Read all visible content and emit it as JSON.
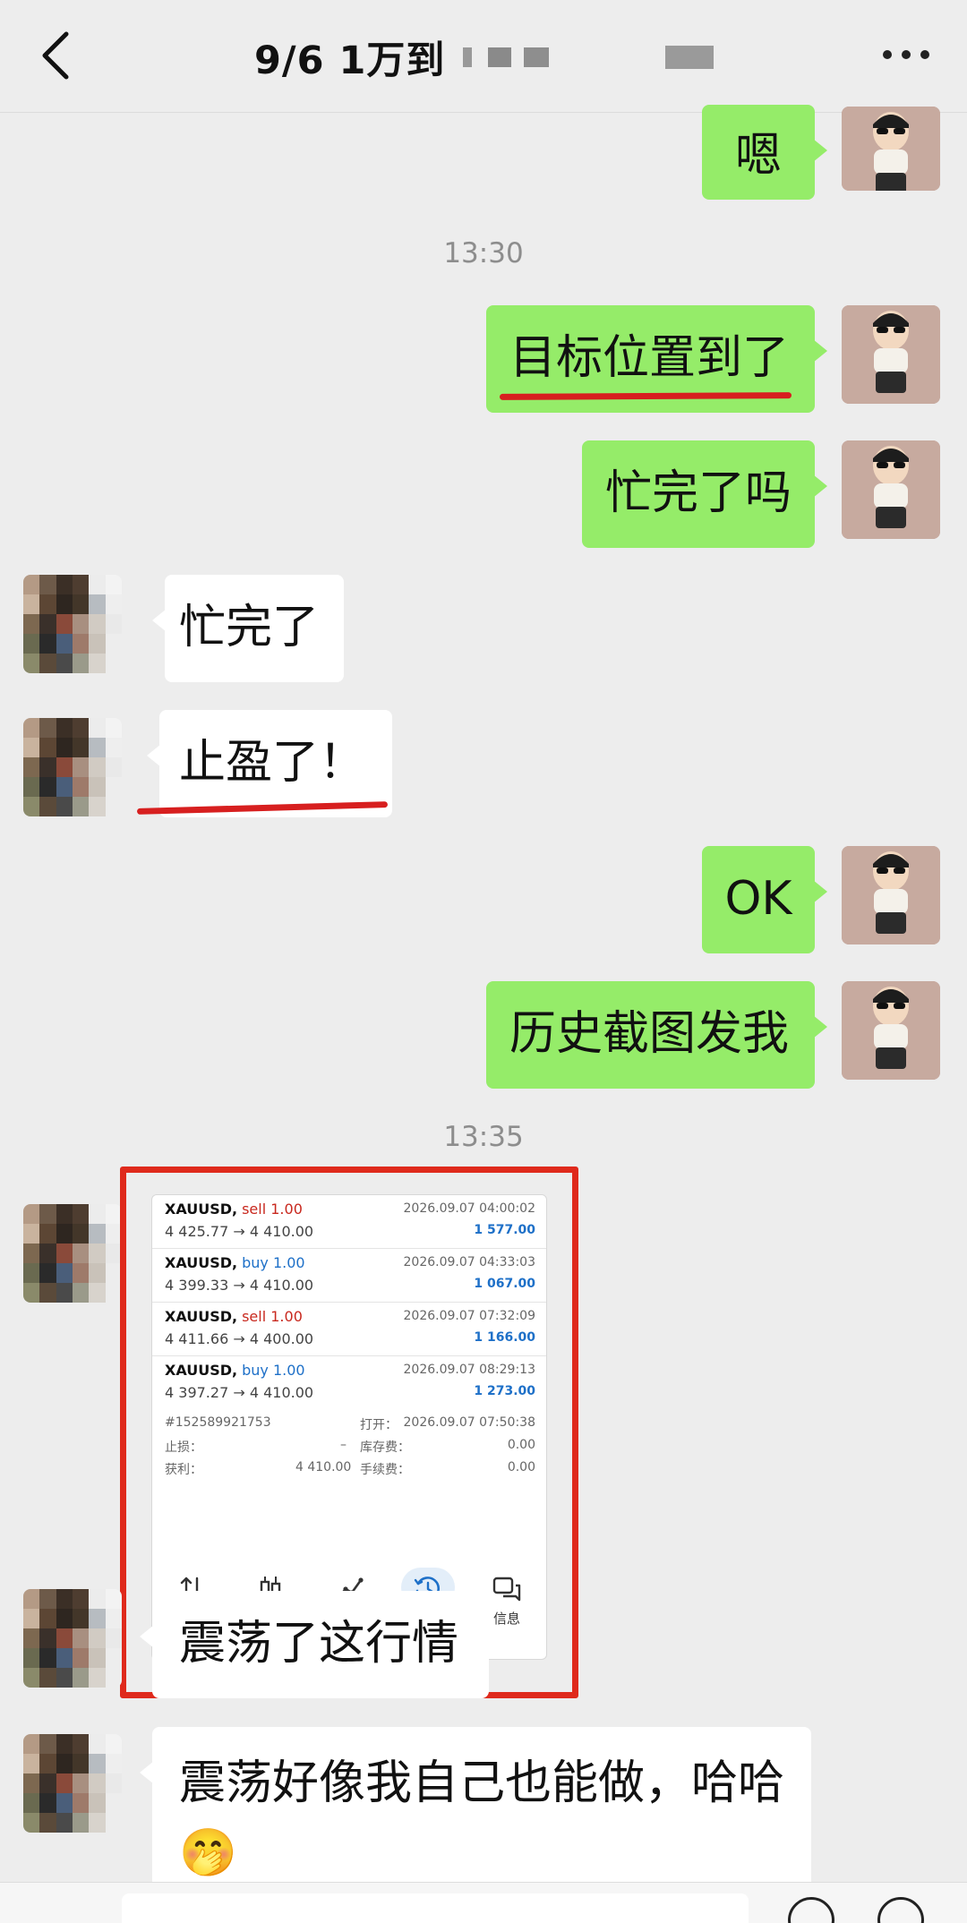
{
  "header": {
    "title": "9/6  1万到",
    "back_icon": "chevron-left-icon",
    "more_icon": "more-dots-icon"
  },
  "colors": {
    "outgoing_bubble": "#95ec69",
    "incoming_bubble": "#ffffff",
    "highlight_underline": "#d71f1f",
    "image_frame": "#df2a1c",
    "background": "#ededed"
  },
  "messages": [
    {
      "side": "out",
      "text": "嗯"
    },
    {
      "type": "time",
      "text": "13:30"
    },
    {
      "side": "out",
      "text": "目标位置到了",
      "underlined": true
    },
    {
      "side": "out",
      "text": "忙完了吗"
    },
    {
      "side": "in",
      "text": "忙完了"
    },
    {
      "side": "in",
      "text": "止盈了！",
      "underlined": true
    },
    {
      "side": "out",
      "text": "OK"
    },
    {
      "side": "out",
      "text": "历史截图发我"
    },
    {
      "type": "time",
      "text": "13:35"
    },
    {
      "side": "in",
      "type": "image"
    },
    {
      "side": "in",
      "text": "震荡了这行情"
    },
    {
      "side": "in",
      "text": "震荡好像我自己也能做，哈哈🤭"
    }
  ],
  "trade_screenshot": {
    "trades": [
      {
        "symbol": "XAUUSD,",
        "side": "sell 1.00",
        "side_kind": "sell",
        "prices": "4 425.77 → 4 410.00",
        "date": "2026.09.07 04:00:02",
        "profit": "1 577.00"
      },
      {
        "symbol": "XAUUSD,",
        "side": "buy 1.00",
        "side_kind": "buy",
        "prices": "4 399.33 → 4 410.00",
        "date": "2026.09.07 04:33:03",
        "profit": "1 067.00"
      },
      {
        "symbol": "XAUUSD,",
        "side": "sell 1.00",
        "side_kind": "sell",
        "prices": "4 411.66 → 4 400.00",
        "date": "2026.09.07 07:32:09",
        "profit": "1 166.00"
      },
      {
        "symbol": "XAUUSD,",
        "side": "buy 1.00",
        "side_kind": "buy",
        "prices": "4 397.27 → 4 410.00",
        "date": "2026.09.07 08:29:13",
        "profit": "1 273.00"
      }
    ],
    "details": {
      "order_id": "#152589921753",
      "open_label": "打开：",
      "open_value": "2026.09.07 07:50:38",
      "sl_label": "止损：",
      "sl_value": "–",
      "swap_label": "库存费：",
      "swap_value": "0.00",
      "tp_label": "获利：",
      "tp_value": "4 410.00",
      "commission_label": "手续费：",
      "commission_value": "0.00"
    },
    "tabs": [
      {
        "label": "行情",
        "icon": "quotes-arrows-icon",
        "active": false
      },
      {
        "label": "图表",
        "icon": "candlestick-chart-icon",
        "active": false
      },
      {
        "label": "交易",
        "icon": "trade-line-icon",
        "active": false
      },
      {
        "label": "历史",
        "icon": "history-clock-icon",
        "active": true
      },
      {
        "label": "信息",
        "icon": "messages-icon",
        "active": false
      }
    ]
  }
}
